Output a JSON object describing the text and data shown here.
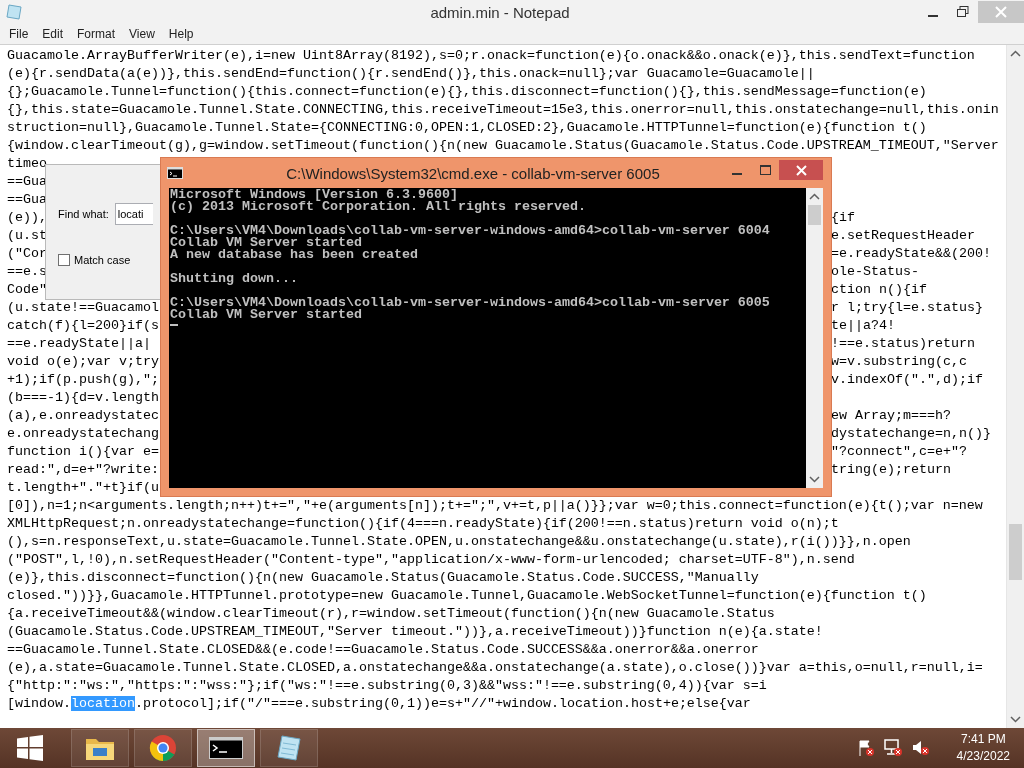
{
  "notepad": {
    "title": "admin.min - Notepad",
    "menu": [
      "File",
      "Edit",
      "Format",
      "View",
      "Help"
    ],
    "lines": [
      {
        "text": "Guacamole.ArrayBufferWriter(e),i=new Uint8Array(8192),s=0;r.onack=function(e){o.onack&&o.onack(e)},this.sendText=function"
      },
      {
        "text": "(e){r.sendData(a(e))},this.sendEnd=function(){r.sendEnd()},this.onack=null};var Guacamole=Guacamole||"
      },
      {
        "text": "{};Guacamole.Tunnel=function(){this.connect=function(e){},this.disconnect=function(){},this.sendMessage=function(e)"
      },
      {
        "text": "{},this.state=Guacamole.Tunnel.State.CONNECTING,this.receiveTimeout=15e3,this.onerror=null,this.onstatechange=null,this.onin"
      },
      {
        "text": "struction=null},Guacamole.Tunnel.State={CONNECTING:0,OPEN:1,CLOSED:2},Guacamole.HTTPTunnel=function(e){function t()"
      },
      {
        "text": "{window.clearTimeout(g),g=window.setTimeout(function(){n(new Guacamole.Status(Guacamole.Status.Code.UPSTREAM_TIMEOUT,\"Server"
      },
      {
        "left": "timeo"
      },
      {
        "left": "==Gua"
      },
      {
        "left": "==Gua"
      },
      {
        "left": "(e)),",
        "right": "{if"
      },
      {
        "left": "(u.st",
        "right": "e.setRequestHeader"
      },
      {
        "left": "(\"Cor",
        "right": "=e.readyState&&(200!"
      },
      {
        "left": "==e.s",
        "right": "ole-Status-"
      },
      {
        "left": "Code\"",
        "right": "ction n(){if"
      },
      {
        "left": "(u.state!==Guacamol",
        "right": "r l;try{l=e.status}"
      },
      {
        "left": "catch(f){l=200}if(s",
        "right": "te||a?4!"
      },
      {
        "left": "==e.readyState||a|",
        "right": "!==e.status)return"
      },
      {
        "left": "void o(e);var v;try",
        "right": "w=v.substring(c,c"
      },
      {
        "left": "+1);if(p.push(g),\";",
        "right": "v.indexOf(\".\",d);if"
      },
      {
        "left": "(b===-1){d=v.length"
      },
      {
        "left": "(a),e.onreadystatec",
        "right": "ew Array;m===h?"
      },
      {
        "left": "e.onreadystatechang",
        "right": "dystatechange=n,n()}"
      },
      {
        "left": "function i(){var e=",
        "right": "\"?connect\",c=e+\"?"
      },
      {
        "left": "read:\",d=e+\"?write:",
        "right": "tring(e);return"
      },
      {
        "left": "t.length+\".\"+t}if(u"
      },
      {
        "text": "[0]),n=1;n<arguments.length;n++)t+=\",\"+e(arguments[n]);t+=\";\",v+=t,p||a()}};var w=0;this.connect=function(e){t();var n=new"
      },
      {
        "text": "XMLHttpRequest;n.onreadystatechange=function(){if(4===n.readyState){if(200!==n.status)return void o(n);t"
      },
      {
        "text": "(),s=n.responseText,u.state=Guacamole.Tunnel.State.OPEN,u.onstatechange&&u.onstatechange(u.state),r(i())}},n.open"
      },
      {
        "text": "(\"POST\",l,!0),n.setRequestHeader(\"Content-type\",\"application/x-www-form-urlencoded; charset=UTF-8\"),n.send"
      },
      {
        "text": "(e)},this.disconnect=function(){n(new Guacamole.Status(Guacamole.Status.Code.SUCCESS,\"Manually"
      },
      {
        "text": "closed.\"))}},Guacamole.HTTPTunnel.prototype=new Guacamole.Tunnel,Guacamole.WebSocketTunnel=function(e){function t()"
      },
      {
        "text": "{a.receiveTimeout&&(window.clearTimeout(r),r=window.setTimeout(function(){n(new Guacamole.Status"
      },
      {
        "text": "(Guacamole.Status.Code.UPSTREAM_TIMEOUT,\"Server timeout.\"))},a.receiveTimeout))}function n(e){a.state!"
      },
      {
        "text": "==Guacamole.Tunnel.State.CLOSED&&(e.code!==Guacamole.Status.Code.SUCCESS&&a.onerror&&a.onerror"
      },
      {
        "text": "(e),a.state=Guacamole.Tunnel.State.CLOSED,a.onstatechange&&a.onstatechange(a.state),o.close())}var a=this,o=null,r=null,i="
      },
      {
        "text": "{\"http:\":\"ws:\",\"https:\":\"wss:\"};if(\"ws:\"!==e.substring(0,3)&&\"wss:\"!==e.substring(0,4)){var s=i"
      },
      {
        "segments": [
          {
            "text": "[window.",
            "selected": false
          },
          {
            "text": "location",
            "selected": true
          },
          {
            "text": ".protocol];if(\"/\"===e.substring(0,1))e=s+\"//\"+window.location.host+e;else{var",
            "selected": false
          }
        ]
      }
    ]
  },
  "find_dialog": {
    "label": "Find what:",
    "value": "locati",
    "match_case": {
      "label": "Match case",
      "checked": false
    }
  },
  "cmd": {
    "title": "C:\\Windows\\System32\\cmd.exe - collab-vm-server  6005",
    "blocks": [
      [
        "Microsoft Windows [Version 6.3.9600]",
        "(c) 2013 Microsoft Corporation. All rights reserved."
      ],
      [
        "C:\\Users\\VM4\\Downloads\\collab-vm-server-windows-amd64>collab-vm-server 6004",
        "Collab VM Server started",
        "A new database has been created"
      ],
      [
        "Shutting down..."
      ],
      [
        "C:\\Users\\VM4\\Downloads\\collab-vm-server-windows-amd64>collab-vm-server 6005",
        "Collab VM Server started"
      ]
    ]
  },
  "taskbar": {
    "apps": [
      {
        "kind": "folder",
        "active": false
      },
      {
        "kind": "browser",
        "active": false
      },
      {
        "kind": "terminal",
        "active": true
      },
      {
        "kind": "notepad",
        "active": false
      }
    ],
    "time": "7:41 PM",
    "date": "4/23/2022"
  }
}
